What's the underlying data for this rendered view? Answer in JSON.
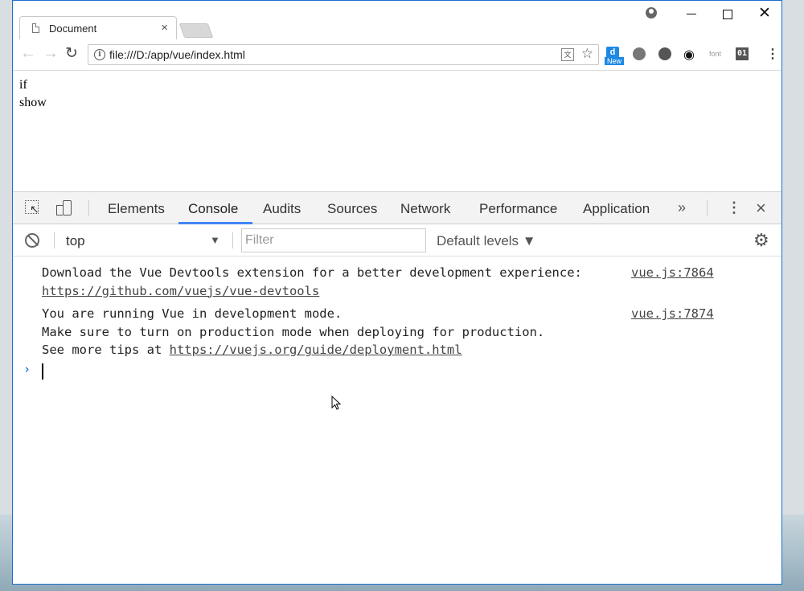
{
  "browser": {
    "tab_title": "Document",
    "tab_close": "×",
    "url": "file:///D:/app/vue/index.html",
    "extensions": {
      "new_badge": "New",
      "font_label": "font",
      "o1_label": "01"
    }
  },
  "page": {
    "lines": [
      "if",
      "show"
    ]
  },
  "devtools": {
    "tabs": [
      "Elements",
      "Console",
      "Audits",
      "Sources",
      "Network",
      "Performance",
      "Application"
    ],
    "active_tab": "Console",
    "more": "»",
    "context": "top",
    "filter_placeholder": "Filter",
    "levels": "Default levels ▼",
    "messages": [
      {
        "lines": [
          "Download the Vue Devtools extension for a better development experience:"
        ],
        "link": "https://github.com/vuejs/vue-devtools",
        "source": "vue.js:7864"
      },
      {
        "lines": [
          "You are running Vue in development mode.",
          "Make sure to turn on production mode when deploying for production."
        ],
        "prefix": "See more tips at ",
        "link": "https://vuejs.org/guide/deployment.html",
        "source": "vue.js:7874"
      }
    ],
    "prompt": "›"
  }
}
